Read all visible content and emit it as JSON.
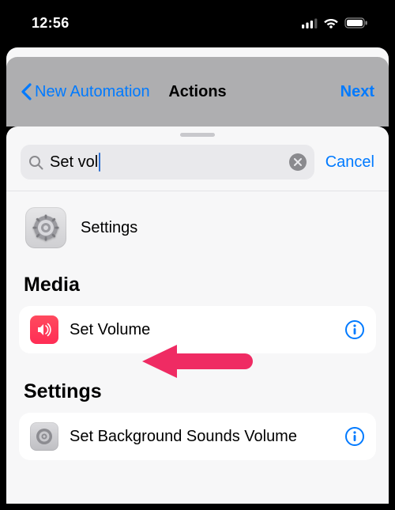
{
  "statusbar": {
    "time": "12:56"
  },
  "nav": {
    "back": "New Automation",
    "title": "Actions",
    "next": "Next"
  },
  "search": {
    "value": "Set vol",
    "cancel": "Cancel"
  },
  "app": {
    "label": "Settings"
  },
  "sections": {
    "media": {
      "title": "Media",
      "items": [
        {
          "label": "Set Volume"
        }
      ]
    },
    "settings": {
      "title": "Settings",
      "items": [
        {
          "label": "Set Background Sounds Volume"
        }
      ]
    }
  }
}
